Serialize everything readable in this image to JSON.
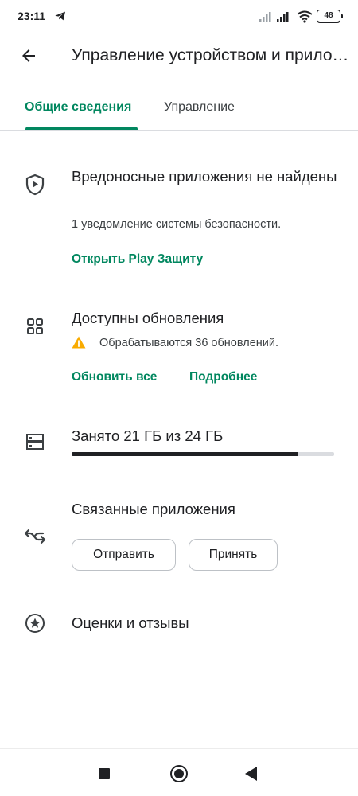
{
  "status_bar": {
    "time": "23:11",
    "battery": "48",
    "icons": [
      "telegram-icon",
      "signal-icon",
      "signal-icon",
      "wifi-icon",
      "battery-icon"
    ]
  },
  "app_bar": {
    "back_icon": "arrow-back-icon",
    "title": "Управление устройством и приложениями"
  },
  "tabs": [
    {
      "label": "Общие сведения",
      "selected": true
    },
    {
      "label": "Управление",
      "selected": false
    }
  ],
  "security": {
    "icon": "shield-play-icon",
    "title": "Вредоносные приложения не найдены",
    "subtitle": "1 уведомление системы безопасности.",
    "link": "Открыть Play Защиту"
  },
  "updates": {
    "icon": "apps-grid-icon",
    "title": "Доступны обновления",
    "warning_icon": "warning-icon",
    "subtitle": "Обрабатываются 36 обновлений.",
    "update_all": "Обновить все",
    "details": "Подробнее"
  },
  "storage": {
    "icon": "storage-icon",
    "title": "Занято 21 ГБ из 24 ГБ",
    "used_fraction": 0.86
  },
  "related_apps": {
    "icon": "nearby-share-icon",
    "title": "Связанные приложения",
    "send": "Отправить",
    "receive": "Принять"
  },
  "ratings": {
    "icon": "star-circle-icon",
    "title": "Оценки и отзывы"
  },
  "colors": {
    "accent": "#01875f",
    "warning": "#f9ab00",
    "text": "#202124"
  },
  "nav_bar": {
    "icons": [
      "recents-icon",
      "home-icon",
      "back-triangle-icon"
    ]
  }
}
